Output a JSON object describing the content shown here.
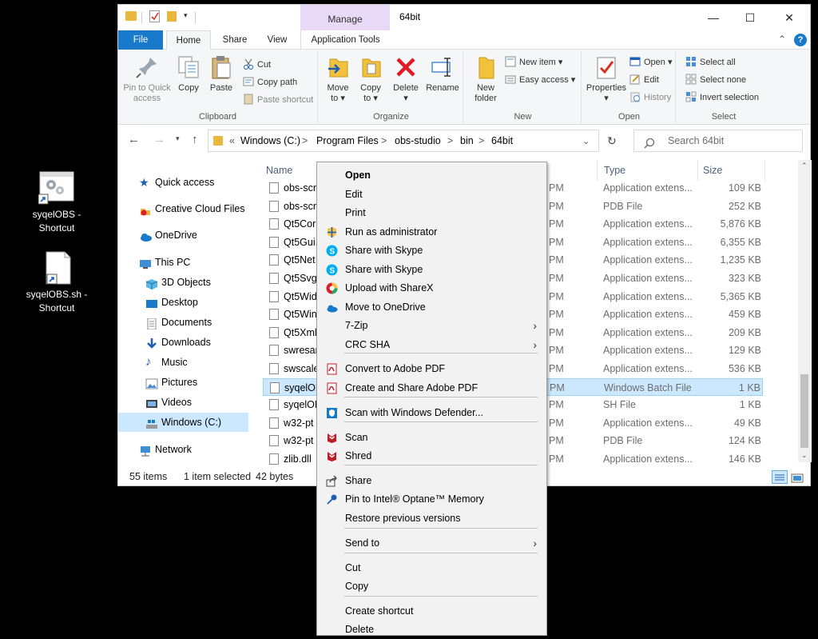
{
  "desktop": {
    "icons": [
      {
        "label_line1": "syqelOBS -",
        "label_line2": "Shortcut",
        "icon": "batch-file-gear-icon"
      },
      {
        "label_line1": "syqelOBS.sh -",
        "label_line2": "Shortcut",
        "icon": "blank-file-icon"
      }
    ]
  },
  "window": {
    "title": "64bit",
    "context_tab": "Manage",
    "controls": {
      "minimize": "—",
      "maximize": "☐",
      "close": "✕"
    }
  },
  "ribbon_tabs": [
    "File",
    "Home",
    "Share",
    "View",
    "Application Tools"
  ],
  "ribbon": {
    "clipboard": {
      "label": "Clipboard",
      "pin": "Pin to Quick access",
      "pin_line1": "Pin to Quick",
      "pin_line2": "access",
      "copy": "Copy",
      "paste": "Paste",
      "cut": "Cut",
      "copy_path": "Copy path",
      "paste_shortcut": "Paste shortcut"
    },
    "organize": {
      "label": "Organize",
      "move_line1": "Move",
      "move_line2": "to ▾",
      "copy_line1": "Copy",
      "copy_line2": "to ▾",
      "delete_line1": "Delete",
      "delete_line2": "▾",
      "rename": "Rename"
    },
    "new": {
      "label": "New",
      "new_folder_line1": "New",
      "new_folder_line2": "folder",
      "new_item": "New item ▾",
      "easy_access": "Easy access ▾"
    },
    "open": {
      "label": "Open",
      "properties_line1": "Properties",
      "properties_line2": "▾",
      "open": "Open ▾",
      "edit": "Edit",
      "history": "History"
    },
    "select": {
      "label": "Select",
      "select_all": "Select all",
      "select_none": "Select none",
      "invert": "Invert selection"
    }
  },
  "address": {
    "path": [
      "«",
      "Windows (C:)",
      ">",
      "Program Files",
      ">",
      "obs-studio",
      ">",
      "bin",
      ">",
      "64bit"
    ],
    "search_placeholder": "Search 64bit"
  },
  "nav": {
    "items": [
      {
        "label": "Quick access",
        "icon": "star-icon"
      },
      {
        "label": "Creative Cloud Files",
        "icon": "creative-cloud-icon"
      },
      {
        "label": "OneDrive",
        "icon": "cloud-icon"
      },
      {
        "label": "This PC",
        "icon": "computer-icon"
      },
      {
        "label": "3D Objects",
        "icon": "cube-icon"
      },
      {
        "label": "Desktop",
        "icon": "desktop-icon"
      },
      {
        "label": "Documents",
        "icon": "document-icon"
      },
      {
        "label": "Downloads",
        "icon": "download-arrow-icon"
      },
      {
        "label": "Music",
        "icon": "music-note-icon"
      },
      {
        "label": "Pictures",
        "icon": "picture-icon"
      },
      {
        "label": "Videos",
        "icon": "video-icon"
      },
      {
        "label": "Windows (C:)",
        "icon": "drive-icon"
      },
      {
        "label": "Network",
        "icon": "network-icon"
      }
    ]
  },
  "columns": {
    "name": "Name",
    "type": "Type",
    "size": "Size"
  },
  "files": [
    {
      "name": "obs-scr",
      "date": "PM",
      "type": "Application extens...",
      "size": "109 KB"
    },
    {
      "name": "obs-scr",
      "date": "PM",
      "type": "PDB File",
      "size": "252 KB"
    },
    {
      "name": "Qt5Cor",
      "date": "PM",
      "type": "Application extens...",
      "size": "5,876 KB"
    },
    {
      "name": "Qt5Gui.",
      "date": "PM",
      "type": "Application extens...",
      "size": "6,355 KB"
    },
    {
      "name": "Qt5Net",
      "date": "PM",
      "type": "Application extens...",
      "size": "1,235 KB"
    },
    {
      "name": "Qt5Svg",
      "date": "PM",
      "type": "Application extens...",
      "size": "323 KB"
    },
    {
      "name": "Qt5Wid",
      "date": "PM",
      "type": "Application extens...",
      "size": "5,365 KB"
    },
    {
      "name": "Qt5Win",
      "date": "PM",
      "type": "Application extens...",
      "size": "459 KB"
    },
    {
      "name": "Qt5Xml",
      "date": "PM",
      "type": "Application extens...",
      "size": "209 KB"
    },
    {
      "name": "swresar",
      "date": "PM",
      "type": "Application extens...",
      "size": "129 KB"
    },
    {
      "name": "swscale",
      "date": "PM",
      "type": "Application extens...",
      "size": "536 KB"
    },
    {
      "name": "syqelOB",
      "date": "PM",
      "type": "Windows Batch File",
      "size": "1 KB",
      "selected": true
    },
    {
      "name": "syqelOB",
      "date": "PM",
      "type": "SH File",
      "size": "1 KB"
    },
    {
      "name": "w32-pt",
      "date": "PM",
      "type": "Application extens...",
      "size": "49 KB"
    },
    {
      "name": "w32-pt",
      "date": "PM",
      "type": "PDB File",
      "size": "124 KB"
    },
    {
      "name": "zlib.dll",
      "date": "PM",
      "type": "Application extens...",
      "size": "146 KB"
    }
  ],
  "status": {
    "count": "55 items",
    "selected": "1 item selected",
    "bytes": "42 bytes"
  },
  "context_menu": {
    "items": [
      {
        "label": "Open",
        "bold": true
      },
      {
        "label": "Edit"
      },
      {
        "label": "Print"
      },
      {
        "label": "Run as administrator",
        "icon": "uac-shield-icon"
      },
      {
        "label": "Share with Skype",
        "icon": "skype-icon"
      },
      {
        "label": "Share with Skype",
        "icon": "skype-icon"
      },
      {
        "label": "Upload with ShareX",
        "icon": "sharex-icon"
      },
      {
        "label": "Move to OneDrive",
        "icon": "onedrive-icon"
      },
      {
        "label": "7-Zip",
        "submenu": true
      },
      {
        "label": "CRC SHA",
        "submenu": true
      },
      {
        "label": "Convert to Adobe PDF",
        "icon": "adobe-pdf-icon"
      },
      {
        "label": "Create and Share Adobe PDF",
        "icon": "adobe-pdf-icon"
      },
      {
        "label": "Scan with Windows Defender...",
        "icon": "defender-icon"
      },
      {
        "label": "Scan",
        "icon": "mcafee-icon"
      },
      {
        "label": "Shred",
        "icon": "mcafee-icon"
      },
      {
        "label": "Share",
        "icon": "share-icon"
      },
      {
        "label": "Pin to Intel® Optane™ Memory",
        "icon": "pin-icon"
      },
      {
        "label": "Restore previous versions"
      },
      {
        "label": "Send to",
        "submenu": true
      },
      {
        "label": "Cut"
      },
      {
        "label": "Copy"
      },
      {
        "label": "Create shortcut"
      },
      {
        "label": "Delete"
      }
    ]
  },
  "colors": {
    "accent": "#1979ca",
    "selection": "#cce8ff",
    "manage_tab": "#e8d9f6"
  }
}
